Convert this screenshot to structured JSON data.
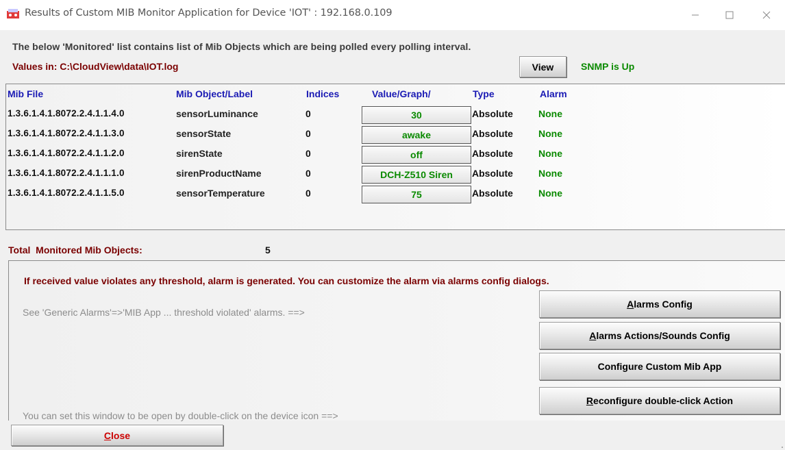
{
  "window": {
    "title": "Results of Custom MIB Monitor Application for Device 'IOT' : 192.168.0.109",
    "minimize_icon": "minimize-icon",
    "maximize_icon": "maximize-icon",
    "close_icon": "close-icon"
  },
  "header": {
    "description": "The below 'Monitored' list contains list of Mib Objects which are being polled every polling interval.",
    "values_in": "Values in: C:\\CloudView\\data\\IOT.log",
    "view_label": "View",
    "snmp_status": "SNMP is Up"
  },
  "table": {
    "columns": [
      "Mib File",
      "Mib Object/Label",
      "Indices",
      "Value/Graph/",
      "Type",
      "Alarm"
    ],
    "rows": [
      {
        "mib_file": "1.3.6.1.4.1.8072.2.4.1.1.4.0",
        "label": "sensorLuminance",
        "index": "0",
        "value": "30",
        "type": "Absolute",
        "alarm": "None"
      },
      {
        "mib_file": "1.3.6.1.4.1.8072.2.4.1.1.3.0",
        "label": "sensorState",
        "index": "0",
        "value": "awake",
        "type": "Absolute",
        "alarm": "None"
      },
      {
        "mib_file": "1.3.6.1.4.1.8072.2.4.1.1.2.0",
        "label": "sirenState",
        "index": "0",
        "value": "off",
        "type": "Absolute",
        "alarm": "None"
      },
      {
        "mib_file": "1.3.6.1.4.1.8072.2.4.1.1.1.0",
        "label": "sirenProductName",
        "index": "0",
        "value": "DCH-Z510 Siren",
        "type": "Absolute",
        "alarm": "None"
      },
      {
        "mib_file": "1.3.6.1.4.1.8072.2.4.1.1.5.0",
        "label": "sensorTemperature",
        "index": "0",
        "value": "75",
        "type": "Absolute",
        "alarm": "None"
      }
    ]
  },
  "totals": {
    "label": "Total  Monitored Mib Objects:",
    "count": "5"
  },
  "alarms_panel": {
    "note": "If received value violates any threshold, alarm is generated. You can customize the alarm via alarms config dialogs.",
    "hint_generic": "See 'Generic Alarms'=>'MIB App ... threshold violated' alarms. ==>",
    "hint_doubleclick": "You can set this window to be open by double-click on the device icon ==>",
    "alarms_config_accel": "A",
    "alarms_config_rest": "larms Config",
    "alarms_actions_accel": "A",
    "alarms_actions_rest": "larms Actions/Sounds Config",
    "configure_label": "Configure Custom Mib App",
    "reconfigure_accel": "R",
    "reconfigure_rest": "econfigure double-click Action"
  },
  "footer": {
    "close_accel": "C",
    "close_rest": "lose"
  },
  "colors": {
    "accent_blue": "#1a1ab4",
    "status_green": "#0a8a00",
    "dark_red": "#7a0000",
    "close_red": "#cc0000"
  }
}
